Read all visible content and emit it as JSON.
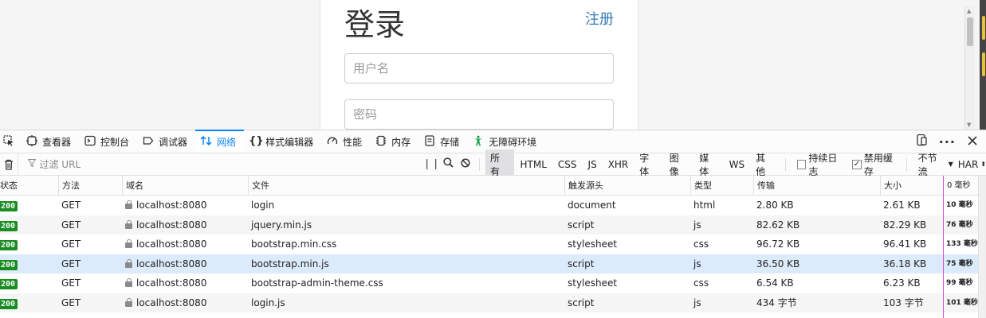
{
  "page": {
    "title": "登录",
    "register_link": "注册",
    "username_placeholder": "用户名",
    "password_placeholder": "密码"
  },
  "devtools": {
    "tabs": [
      {
        "label": "查看器",
        "icon": "inspector-icon"
      },
      {
        "label": "控制台",
        "icon": "console-icon"
      },
      {
        "label": "调试器",
        "icon": "debugger-icon"
      },
      {
        "label": "网络",
        "icon": "network-icon",
        "active": true
      },
      {
        "label": "样式编辑器",
        "icon": "style-editor-icon"
      },
      {
        "label": "性能",
        "icon": "performance-icon"
      },
      {
        "label": "内存",
        "icon": "memory-icon"
      },
      {
        "label": "存储",
        "icon": "storage-icon"
      },
      {
        "label": "无障碍环境",
        "icon": "accessibility-icon"
      }
    ],
    "accent_color": "#0a84ff"
  },
  "filterbar": {
    "url_placeholder": "过滤 URL",
    "types": [
      "所有",
      "HTML",
      "CSS",
      "JS",
      "XHR",
      "字体",
      "图像",
      "媒体",
      "WS",
      "其他"
    ],
    "selected_type": "所有",
    "persist_logs": {
      "label": "持续日志",
      "checked": false
    },
    "disable_cache": {
      "label": "禁用缓存",
      "checked": true
    },
    "throttle": "不节流",
    "har": "HAR"
  },
  "table": {
    "columns": [
      "状态",
      "方法",
      "域名",
      "文件",
      "触发源头",
      "类型",
      "传输",
      "大小",
      "0 毫秒"
    ],
    "rows": [
      {
        "status": "200",
        "method": "GET",
        "domain": "localhost:8080",
        "file": "login",
        "cause": "document",
        "type": "html",
        "transferred": "2.80 KB",
        "size": "2.61 KB",
        "time": "10 毫秒"
      },
      {
        "status": "200",
        "method": "GET",
        "domain": "localhost:8080",
        "file": "jquery.min.js",
        "cause": "script",
        "type": "js",
        "transferred": "82.62 KB",
        "size": "82.29 KB",
        "time": "76 毫秒"
      },
      {
        "status": "200",
        "method": "GET",
        "domain": "localhost:8080",
        "file": "bootstrap.min.css",
        "cause": "stylesheet",
        "type": "css",
        "transferred": "96.72 KB",
        "size": "96.41 KB",
        "time": "133 毫秒"
      },
      {
        "status": "200",
        "method": "GET",
        "domain": "localhost:8080",
        "file": "bootstrap.min.js",
        "cause": "script",
        "type": "js",
        "transferred": "36.50 KB",
        "size": "36.18 KB",
        "time": "75 毫秒"
      },
      {
        "status": "200",
        "method": "GET",
        "domain": "localhost:8080",
        "file": "bootstrap-admin-theme.css",
        "cause": "stylesheet",
        "type": "css",
        "transferred": "6.54 KB",
        "size": "6.23 KB",
        "time": "99 毫秒"
      },
      {
        "status": "200",
        "method": "GET",
        "domain": "localhost:8080",
        "file": "login.js",
        "cause": "script",
        "type": "js",
        "transferred": "434 字节",
        "size": "103 字节",
        "time": "101 毫秒"
      }
    ],
    "selected_row": 3
  }
}
